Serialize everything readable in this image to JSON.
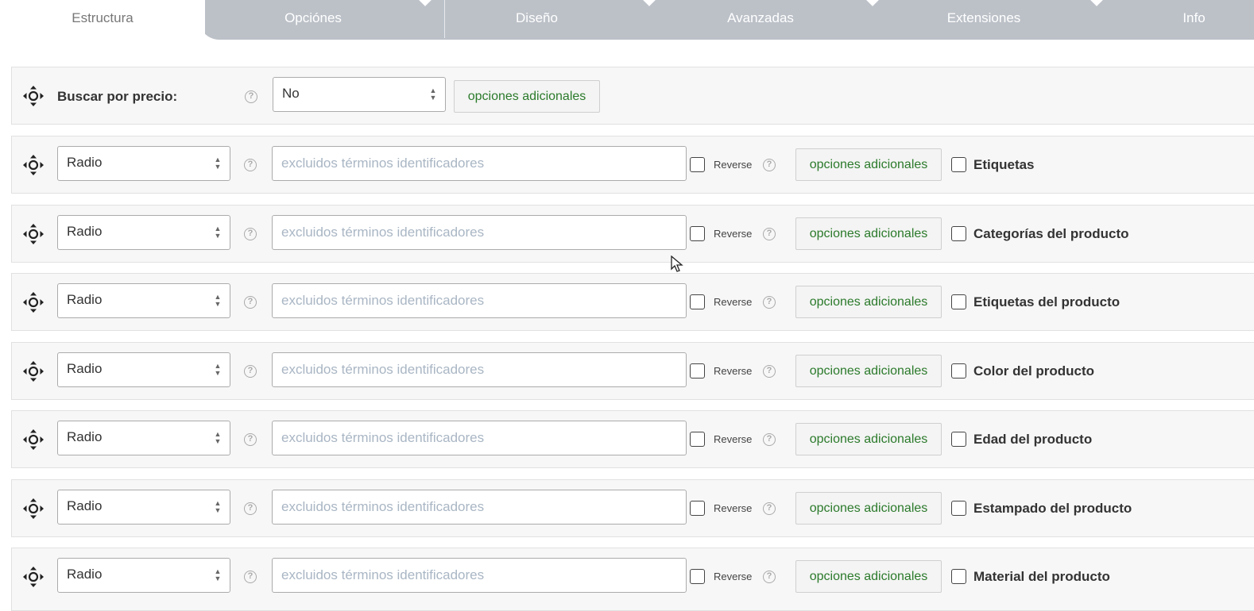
{
  "tabs": [
    {
      "label": "Estructura",
      "active": true
    },
    {
      "label": "Opciónes",
      "active": false
    },
    {
      "label": "Diseño",
      "active": false
    },
    {
      "label": "Avanzadas",
      "active": false
    },
    {
      "label": "Extensiones",
      "active": false
    },
    {
      "label": "Info",
      "active": false
    }
  ],
  "price_row": {
    "title": "Buscar por precio:",
    "select_value": "No",
    "button_label": "opciones adicionales"
  },
  "taxonomy_rows": [
    {
      "select_value": "Radio",
      "placeholder": "excluidos términos identificadores",
      "reverse_label": "Reverse",
      "button_label": "opciones adicionales",
      "term_label": "Etiquetas"
    },
    {
      "select_value": "Radio",
      "placeholder": "excluidos términos identificadores",
      "reverse_label": "Reverse",
      "button_label": "opciones adicionales",
      "term_label": "Categorías del producto"
    },
    {
      "select_value": "Radio",
      "placeholder": "excluidos términos identificadores",
      "reverse_label": "Reverse",
      "button_label": "opciones adicionales",
      "term_label": "Etiquetas del producto"
    },
    {
      "select_value": "Radio",
      "placeholder": "excluidos términos identificadores",
      "reverse_label": "Reverse",
      "button_label": "opciones adicionales",
      "term_label": "Color del producto"
    },
    {
      "select_value": "Radio",
      "placeholder": "excluidos términos identificadores",
      "reverse_label": "Reverse",
      "button_label": "opciones adicionales",
      "term_label": "Edad del producto"
    },
    {
      "select_value": "Radio",
      "placeholder": "excluidos términos identificadores",
      "reverse_label": "Reverse",
      "button_label": "opciones adicionales",
      "term_label": "Estampado del producto"
    },
    {
      "select_value": "Radio",
      "placeholder": "excluidos términos identificadores",
      "reverse_label": "Reverse",
      "button_label": "opciones adicionales",
      "term_label": "Material del producto"
    }
  ],
  "icons": {
    "move": "move-arrows-icon",
    "help": "question-circle-icon",
    "select_arrows": "up-down-arrows-icon"
  },
  "colors": {
    "tab_bg": "#bcc1c8",
    "button_text": "#2b7a2b",
    "placeholder": "#a9b6c4",
    "row_bg": "#f7f7f7"
  }
}
